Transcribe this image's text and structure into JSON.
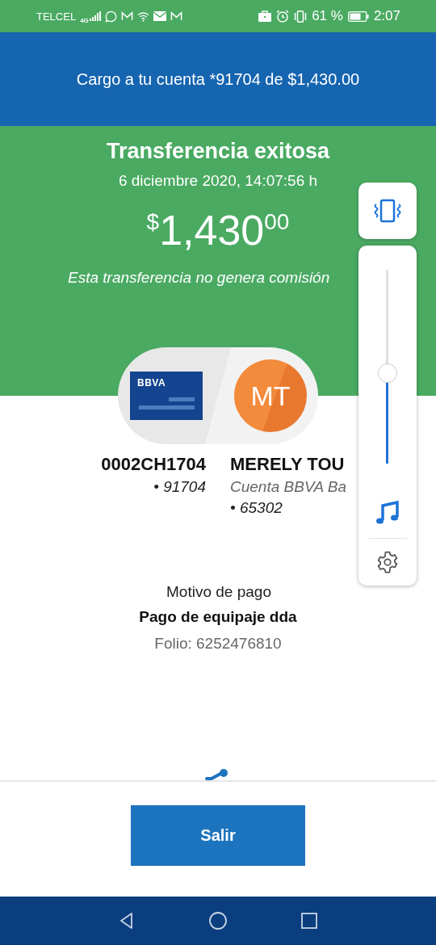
{
  "status_bar": {
    "carrier": "TELCEL",
    "network": "4G",
    "battery": "61 %",
    "time": "2:07"
  },
  "header": {
    "title": "Cargo a tu cuenta *91704 de $1,430.00"
  },
  "result": {
    "title": "Transferencia exitosa",
    "date": "6 diciembre 2020, 14:07:56 h",
    "currency": "$",
    "amount": "1,430",
    "cents": "00",
    "note": "Esta transferencia no genera comisión"
  },
  "origin": {
    "logo": "BBVA",
    "name": "0002CH1704",
    "account": "• 91704"
  },
  "destination": {
    "initials": "MT",
    "name": "MERELY TOU",
    "bank": "Cuenta BBVA Ba",
    "account": "• 65302"
  },
  "details": {
    "label": "Motivo de pago",
    "value": "Pago de equipaje dda",
    "folio": "Folio: 6252476810"
  },
  "exit_button": {
    "label": "Salir"
  },
  "volume_panel": {
    "vibrate": true,
    "level": 0.47
  }
}
